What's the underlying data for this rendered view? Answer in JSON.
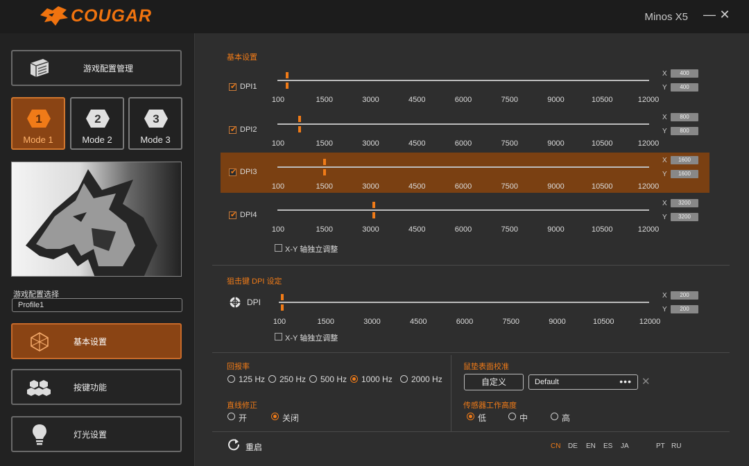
{
  "app": {
    "brand": "COUGAR",
    "title": "Minos X5"
  },
  "sidebar": {
    "profile_manager": "游戏配置管理",
    "modes": [
      {
        "num": "1",
        "label": "Mode 1"
      },
      {
        "num": "2",
        "label": "Mode 2"
      },
      {
        "num": "3",
        "label": "Mode 3"
      }
    ],
    "profile_select_label": "游戏配置选择",
    "profile_value": "Profile1",
    "nav": [
      {
        "label": "基本设置",
        "active": true
      },
      {
        "label": "按键功能",
        "active": false
      },
      {
        "label": "灯光设置",
        "active": false
      }
    ]
  },
  "main": {
    "basic_title": "基本设置",
    "ticks": [
      "100",
      "1500",
      "3000",
      "4500",
      "6000",
      "7500",
      "9000",
      "10500",
      "12000"
    ],
    "dpi_rows": [
      {
        "label": "DPI1",
        "x": "400",
        "y": "400",
        "value": 400
      },
      {
        "label": "DPI2",
        "x": "800",
        "y": "800",
        "value": 800
      },
      {
        "label": "DPI3",
        "x": "1600",
        "y": "1600",
        "value": 1600
      },
      {
        "label": "DPI4",
        "x": "3200",
        "y": "3200",
        "value": 3200
      }
    ],
    "xy_independent": "X-Y 轴独立调整",
    "sniper_title": "狙击键 DPI 设定",
    "sniper": {
      "label": "DPI",
      "x": "200",
      "y": "200",
      "value": 200
    },
    "polling_title": "回报率",
    "polling_options": [
      "125 Hz",
      "250 Hz",
      "500 Hz",
      "1000 Hz",
      "2000 Hz"
    ],
    "polling_selected": "1000 Hz",
    "angle_title": "直线修正",
    "angle_options": [
      "开",
      "关闭"
    ],
    "angle_selected": "关闭",
    "surface_title": "鼠垫表面校准",
    "surface_custom": "自定义",
    "surface_value": "Default",
    "lod_title": "传感器工作高度",
    "lod_options": [
      "低",
      "中",
      "高"
    ],
    "lod_selected": "低",
    "reset_label": "重启",
    "languages": [
      "CN",
      "DE",
      "EN",
      "ES",
      "JA",
      "PT",
      "RU"
    ],
    "language_selected": "CN"
  },
  "colors": {
    "accent": "#f07b18",
    "highlight_row": "#7a4012",
    "active_button": "#8a4414"
  }
}
